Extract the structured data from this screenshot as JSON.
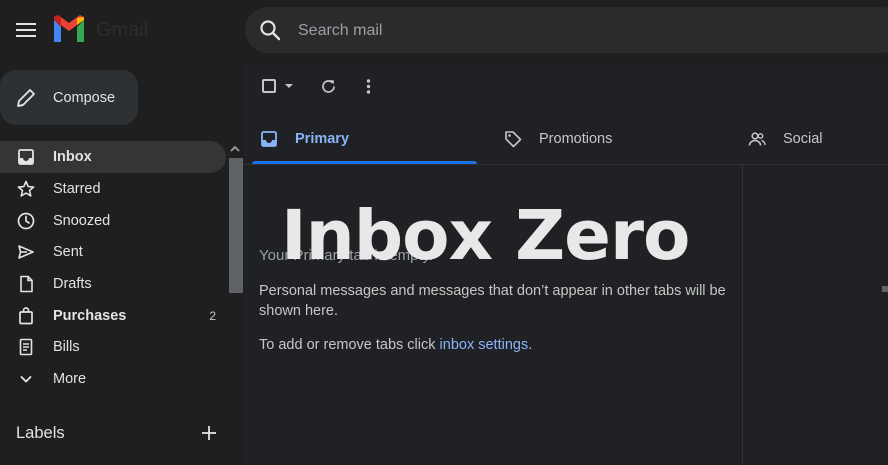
{
  "header": {
    "app_name": "Gmail",
    "search_placeholder": "Search mail"
  },
  "compose": {
    "label": "Compose"
  },
  "sidebar": {
    "items": [
      {
        "label": "Inbox",
        "icon": "inbox-icon",
        "active": true
      },
      {
        "label": "Starred",
        "icon": "star-icon"
      },
      {
        "label": "Snoozed",
        "icon": "clock-icon"
      },
      {
        "label": "Sent",
        "icon": "send-icon"
      },
      {
        "label": "Drafts",
        "icon": "draft-icon"
      },
      {
        "label": "Purchases",
        "icon": "shopping-bag-icon",
        "count": "2"
      },
      {
        "label": "Bills",
        "icon": "receipt-icon"
      },
      {
        "label": "More",
        "icon": "chevron-down-icon"
      }
    ],
    "labels_title": "Labels"
  },
  "tabs": [
    {
      "label": "Primary",
      "icon": "inbox-icon",
      "selected": true
    },
    {
      "label": "Promotions",
      "icon": "tag-icon"
    },
    {
      "label": "Social",
      "icon": "people-icon"
    }
  ],
  "empty_state": {
    "title": "Your Primary tab is empty.",
    "description": "Personal messages and messages that don’t appear in other tabs will be shown here.",
    "settings_prefix": "To add or remove tabs click ",
    "settings_link": "inbox settings",
    "settings_suffix": "."
  },
  "overlay": {
    "title": "Inbox Zero"
  },
  "colors": {
    "background": "#1f1f1f",
    "accent": "#8ab4f8",
    "active_item": "#333537"
  }
}
